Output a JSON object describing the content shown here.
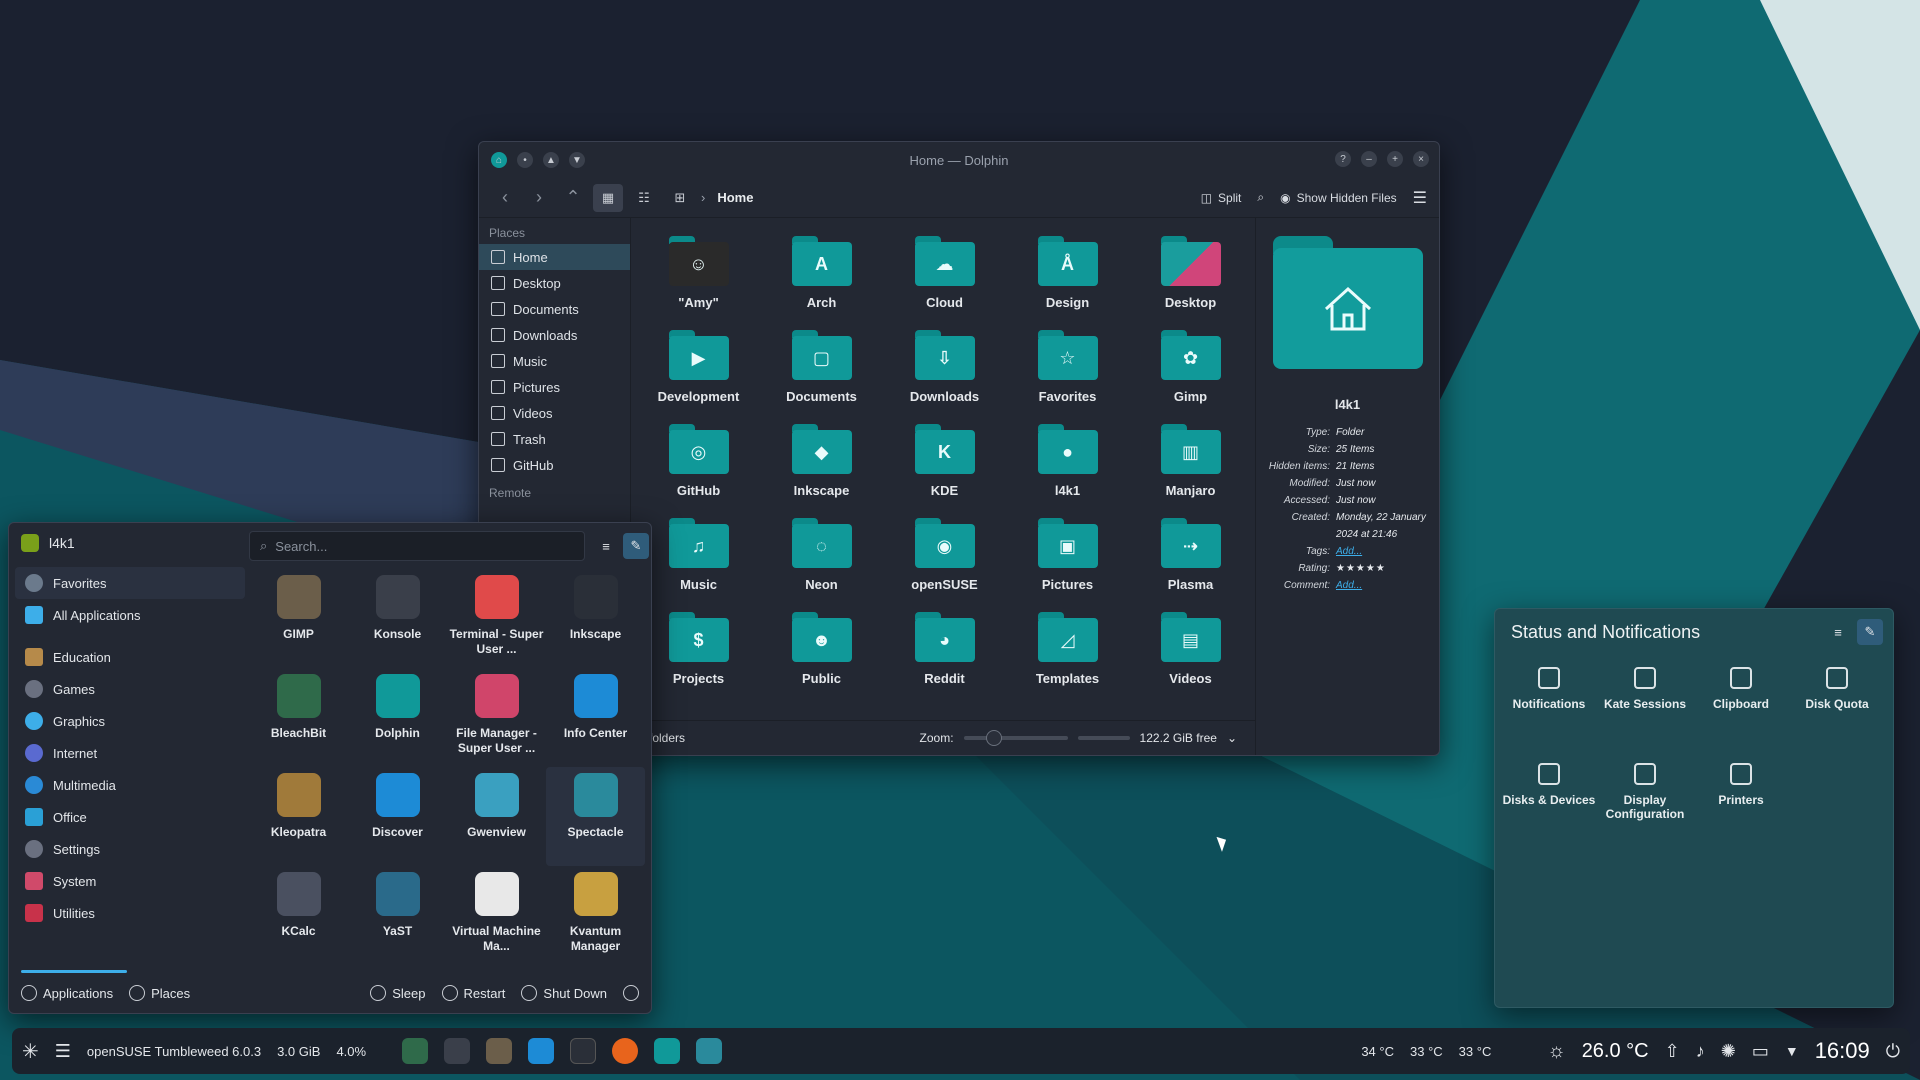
{
  "window": {
    "title": "Home — Dolphin",
    "breadcrumb": "Home",
    "toolbar": {
      "split": "Split",
      "show_hidden": "Show Hidden Files"
    },
    "places_header": "Places",
    "remote_header": "Remote",
    "places": [
      "Home",
      "Desktop",
      "Documents",
      "Downloads",
      "Music",
      "Pictures",
      "Videos",
      "Trash",
      "GitHub"
    ],
    "files": [
      "\"Amy\"",
      "Arch",
      "Cloud",
      "Design",
      "Desktop",
      "Development",
      "Documents",
      "Downloads",
      "Favorites",
      "Gimp",
      "GitHub",
      "Inkscape",
      "KDE",
      "l4k1",
      "Manjaro",
      "Music",
      "Neon",
      "openSUSE",
      "Pictures",
      "Plasma",
      "Projects",
      "Public",
      "Reddit",
      "Templates",
      "Videos"
    ],
    "status": {
      "left": "folders",
      "zoom_label": "Zoom:",
      "free": "122.2 GiB free"
    },
    "info": {
      "name": "l4k1",
      "rows": [
        {
          "k": "Type:",
          "v": "Folder"
        },
        {
          "k": "Size:",
          "v": "25 Items"
        },
        {
          "k": "Hidden items:",
          "v": "21 Items"
        },
        {
          "k": "Modified:",
          "v": "Just now"
        },
        {
          "k": "Accessed:",
          "v": "Just now"
        },
        {
          "k": "Created:",
          "v": "Monday, 22 January 2024 at 21:46"
        },
        {
          "k": "Tags:",
          "v": "Add..."
        },
        {
          "k": "Rating:",
          "v": "★★★★★"
        },
        {
          "k": "Comment:",
          "v": "Add..."
        }
      ]
    }
  },
  "menu": {
    "user": "l4k1",
    "search_placeholder": "Search...",
    "categories": [
      "Favorites",
      "All Applications",
      "Education",
      "Games",
      "Graphics",
      "Internet",
      "Multimedia",
      "Office",
      "Settings",
      "System",
      "Utilities"
    ],
    "apps": [
      "GIMP",
      "Konsole",
      "Terminal - Super User ...",
      "Inkscape",
      "BleachBit",
      "Dolphin",
      "File Manager - Super User ...",
      "Info Center",
      "Kleopatra",
      "Discover",
      "Gwenview",
      "Spectacle",
      "KCalc",
      "YaST",
      "Virtual Machine Ma...",
      "Kvantum Manager"
    ],
    "footer": {
      "applications": "Applications",
      "places": "Places",
      "sleep": "Sleep",
      "restart": "Restart",
      "shutdown": "Shut Down"
    }
  },
  "notifications_panel": {
    "title": "Status and Notifications",
    "items": [
      "Notifications",
      "Kate Sessions",
      "Clipboard",
      "Disk Quota",
      "Disks & Devices",
      "Display Configuration",
      "Printers"
    ]
  },
  "taskbar": {
    "distro": "openSUSE Tumbleweed 6.0.3",
    "mem": "3.0 GiB",
    "cpu": "4.0%",
    "temps": [
      "34 °C",
      "33 °C",
      "33 °C"
    ],
    "weather": "26.0 °C",
    "clock": "16:09"
  },
  "colors": {
    "accent": "#3daee9",
    "folder": "#109999",
    "bg": "#1a2030"
  }
}
